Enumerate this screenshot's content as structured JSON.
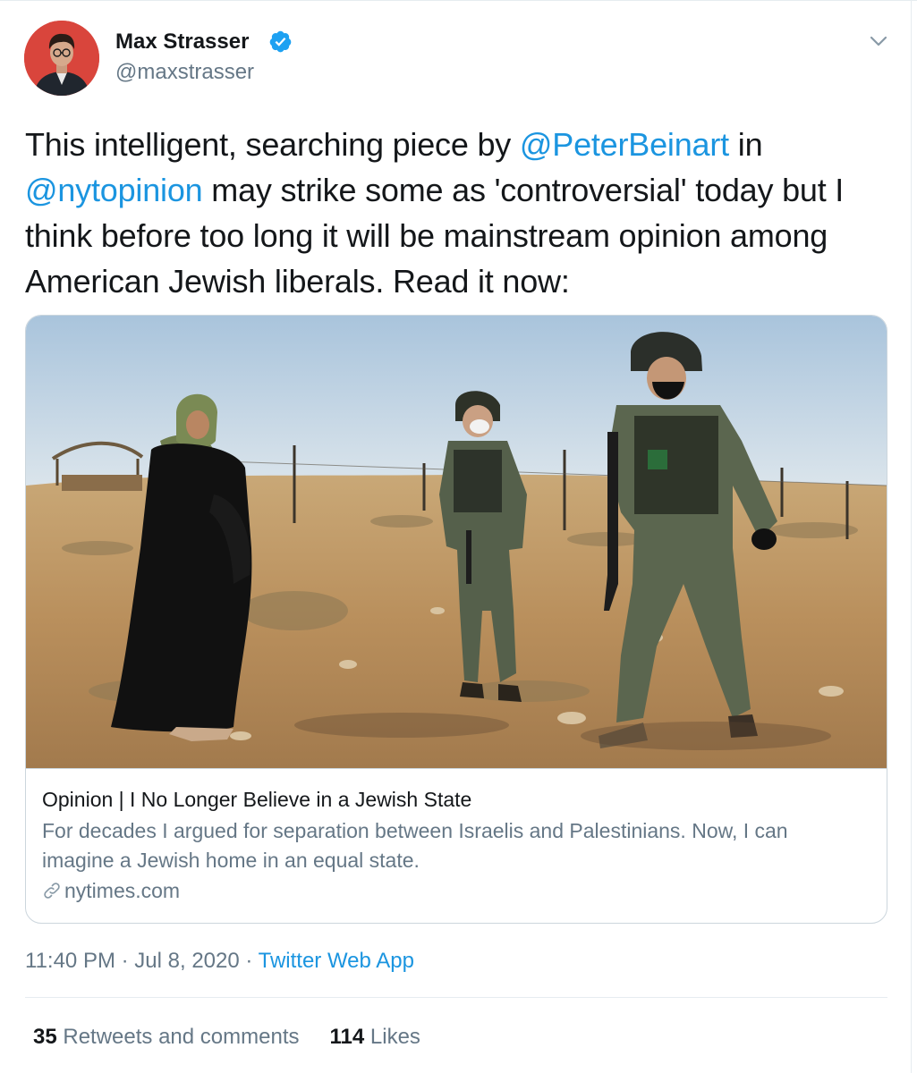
{
  "author": {
    "name": "Max Strasser",
    "handle": "@maxstrasser"
  },
  "tweet": {
    "segments": [
      {
        "text": "This intelligent, searching piece by ",
        "mention": false
      },
      {
        "text": "@PeterBeinart",
        "mention": true
      },
      {
        "text": " in ",
        "mention": false
      },
      {
        "text": "@nytopinion",
        "mention": true
      },
      {
        "text": " may strike some as 'controversial' today but I think before too long it will be mainstream opinion among American Jewish liberals. Read it now:",
        "mention": false
      }
    ]
  },
  "card": {
    "title": "Opinion | I No Longer Believe in a Jewish State",
    "description": "For decades I argued for separation between Israelis and Palestinians. Now, I can imagine a Jewish home in an equal state.",
    "domain": "nytimes.com",
    "image_icon": "photo-woman-and-soldiers-in-field"
  },
  "meta": {
    "time": "11:40 PM",
    "separator": " · ",
    "date": "Jul 8, 2020",
    "app": "Twitter Web App"
  },
  "stats": {
    "retweets_count": "35",
    "retweets_label": "Retweets and comments",
    "likes_count": "114",
    "likes_label": "Likes"
  },
  "colors": {
    "link": "#1b95e0",
    "muted": "#657786",
    "text": "#14171a",
    "border": "#ccd6dd",
    "avatar_bg": "#d9453c"
  }
}
